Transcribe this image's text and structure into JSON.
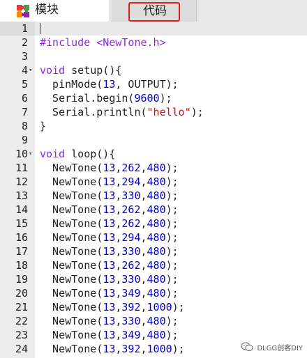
{
  "tabs": {
    "blocks_label": "模块",
    "code_label": "代码"
  },
  "editor": {
    "lines": [
      {
        "n": "1",
        "fold": "",
        "tokens": []
      },
      {
        "n": "2",
        "fold": "",
        "tokens": [
          {
            "t": "#include ",
            "c": "k"
          },
          {
            "t": "<NewTone.h>",
            "c": "k"
          }
        ]
      },
      {
        "n": "3",
        "fold": "",
        "tokens": []
      },
      {
        "n": "4",
        "fold": "▾",
        "tokens": [
          {
            "t": "void",
            "c": "k"
          },
          {
            "t": " setup(){",
            "c": ""
          }
        ]
      },
      {
        "n": "5",
        "fold": "",
        "tokens": [
          {
            "t": "  pinMode(",
            "c": ""
          },
          {
            "t": "13",
            "c": "n"
          },
          {
            "t": ", OUTPUT);",
            "c": ""
          }
        ]
      },
      {
        "n": "6",
        "fold": "",
        "tokens": [
          {
            "t": "  Serial.begin(",
            "c": ""
          },
          {
            "t": "9600",
            "c": "n"
          },
          {
            "t": ");",
            "c": ""
          }
        ]
      },
      {
        "n": "7",
        "fold": "",
        "tokens": [
          {
            "t": "  Serial.println(",
            "c": ""
          },
          {
            "t": "\"hello\"",
            "c": "s"
          },
          {
            "t": ");",
            "c": ""
          }
        ]
      },
      {
        "n": "8",
        "fold": "",
        "tokens": [
          {
            "t": "}",
            "c": ""
          }
        ]
      },
      {
        "n": "9",
        "fold": "",
        "tokens": []
      },
      {
        "n": "10",
        "fold": "▾",
        "tokens": [
          {
            "t": "void",
            "c": "k"
          },
          {
            "t": " loop(){",
            "c": ""
          }
        ]
      },
      {
        "n": "11",
        "fold": "",
        "tokens": [
          {
            "t": "  NewTone(",
            "c": ""
          },
          {
            "t": "13",
            "c": "n"
          },
          {
            "t": ",",
            "c": ""
          },
          {
            "t": "262",
            "c": "n"
          },
          {
            "t": ",",
            "c": ""
          },
          {
            "t": "480",
            "c": "n"
          },
          {
            "t": ");",
            "c": ""
          }
        ]
      },
      {
        "n": "12",
        "fold": "",
        "tokens": [
          {
            "t": "  NewTone(",
            "c": ""
          },
          {
            "t": "13",
            "c": "n"
          },
          {
            "t": ",",
            "c": ""
          },
          {
            "t": "294",
            "c": "n"
          },
          {
            "t": ",",
            "c": ""
          },
          {
            "t": "480",
            "c": "n"
          },
          {
            "t": ");",
            "c": ""
          }
        ]
      },
      {
        "n": "13",
        "fold": "",
        "tokens": [
          {
            "t": "  NewTone(",
            "c": ""
          },
          {
            "t": "13",
            "c": "n"
          },
          {
            "t": ",",
            "c": ""
          },
          {
            "t": "330",
            "c": "n"
          },
          {
            "t": ",",
            "c": ""
          },
          {
            "t": "480",
            "c": "n"
          },
          {
            "t": ");",
            "c": ""
          }
        ]
      },
      {
        "n": "14",
        "fold": "",
        "tokens": [
          {
            "t": "  NewTone(",
            "c": ""
          },
          {
            "t": "13",
            "c": "n"
          },
          {
            "t": ",",
            "c": ""
          },
          {
            "t": "262",
            "c": "n"
          },
          {
            "t": ",",
            "c": ""
          },
          {
            "t": "480",
            "c": "n"
          },
          {
            "t": ");",
            "c": ""
          }
        ]
      },
      {
        "n": "15",
        "fold": "",
        "tokens": [
          {
            "t": "  NewTone(",
            "c": ""
          },
          {
            "t": "13",
            "c": "n"
          },
          {
            "t": ",",
            "c": ""
          },
          {
            "t": "262",
            "c": "n"
          },
          {
            "t": ",",
            "c": ""
          },
          {
            "t": "480",
            "c": "n"
          },
          {
            "t": ");",
            "c": ""
          }
        ]
      },
      {
        "n": "16",
        "fold": "",
        "tokens": [
          {
            "t": "  NewTone(",
            "c": ""
          },
          {
            "t": "13",
            "c": "n"
          },
          {
            "t": ",",
            "c": ""
          },
          {
            "t": "294",
            "c": "n"
          },
          {
            "t": ",",
            "c": ""
          },
          {
            "t": "480",
            "c": "n"
          },
          {
            "t": ");",
            "c": ""
          }
        ]
      },
      {
        "n": "17",
        "fold": "",
        "tokens": [
          {
            "t": "  NewTone(",
            "c": ""
          },
          {
            "t": "13",
            "c": "n"
          },
          {
            "t": ",",
            "c": ""
          },
          {
            "t": "330",
            "c": "n"
          },
          {
            "t": ",",
            "c": ""
          },
          {
            "t": "480",
            "c": "n"
          },
          {
            "t": ");",
            "c": ""
          }
        ]
      },
      {
        "n": "18",
        "fold": "",
        "tokens": [
          {
            "t": "  NewTone(",
            "c": ""
          },
          {
            "t": "13",
            "c": "n"
          },
          {
            "t": ",",
            "c": ""
          },
          {
            "t": "262",
            "c": "n"
          },
          {
            "t": ",",
            "c": ""
          },
          {
            "t": "480",
            "c": "n"
          },
          {
            "t": ");",
            "c": ""
          }
        ]
      },
      {
        "n": "19",
        "fold": "",
        "tokens": [
          {
            "t": "  NewTone(",
            "c": ""
          },
          {
            "t": "13",
            "c": "n"
          },
          {
            "t": ",",
            "c": ""
          },
          {
            "t": "330",
            "c": "n"
          },
          {
            "t": ",",
            "c": ""
          },
          {
            "t": "480",
            "c": "n"
          },
          {
            "t": ");",
            "c": ""
          }
        ]
      },
      {
        "n": "20",
        "fold": "",
        "tokens": [
          {
            "t": "  NewTone(",
            "c": ""
          },
          {
            "t": "13",
            "c": "n"
          },
          {
            "t": ",",
            "c": ""
          },
          {
            "t": "349",
            "c": "n"
          },
          {
            "t": ",",
            "c": ""
          },
          {
            "t": "480",
            "c": "n"
          },
          {
            "t": ");",
            "c": ""
          }
        ]
      },
      {
        "n": "21",
        "fold": "",
        "tokens": [
          {
            "t": "  NewTone(",
            "c": ""
          },
          {
            "t": "13",
            "c": "n"
          },
          {
            "t": ",",
            "c": ""
          },
          {
            "t": "392",
            "c": "n"
          },
          {
            "t": ",",
            "c": ""
          },
          {
            "t": "1000",
            "c": "n"
          },
          {
            "t": ");",
            "c": ""
          }
        ]
      },
      {
        "n": "22",
        "fold": "",
        "tokens": [
          {
            "t": "  NewTone(",
            "c": ""
          },
          {
            "t": "13",
            "c": "n"
          },
          {
            "t": ",",
            "c": ""
          },
          {
            "t": "330",
            "c": "n"
          },
          {
            "t": ",",
            "c": ""
          },
          {
            "t": "480",
            "c": "n"
          },
          {
            "t": ");",
            "c": ""
          }
        ]
      },
      {
        "n": "23",
        "fold": "",
        "tokens": [
          {
            "t": "  NewTone(",
            "c": ""
          },
          {
            "t": "13",
            "c": "n"
          },
          {
            "t": ",",
            "c": ""
          },
          {
            "t": "349",
            "c": "n"
          },
          {
            "t": ",",
            "c": ""
          },
          {
            "t": "480",
            "c": "n"
          },
          {
            "t": ");",
            "c": ""
          }
        ]
      },
      {
        "n": "24",
        "fold": "",
        "tokens": [
          {
            "t": "  NewTone(",
            "c": ""
          },
          {
            "t": "13",
            "c": "n"
          },
          {
            "t": ",",
            "c": ""
          },
          {
            "t": "392",
            "c": "n"
          },
          {
            "t": ",",
            "c": ""
          },
          {
            "t": "1000",
            "c": "n"
          },
          {
            "t": ");",
            "c": ""
          }
        ]
      }
    ]
  },
  "watermark": {
    "text": "DLGG创客DIY",
    "icon": "wechat-icon"
  },
  "colors": {
    "keyword": "#8a2be2",
    "number": "#0000cd",
    "string": "#c81414",
    "tab_highlight": "#e0201c"
  }
}
